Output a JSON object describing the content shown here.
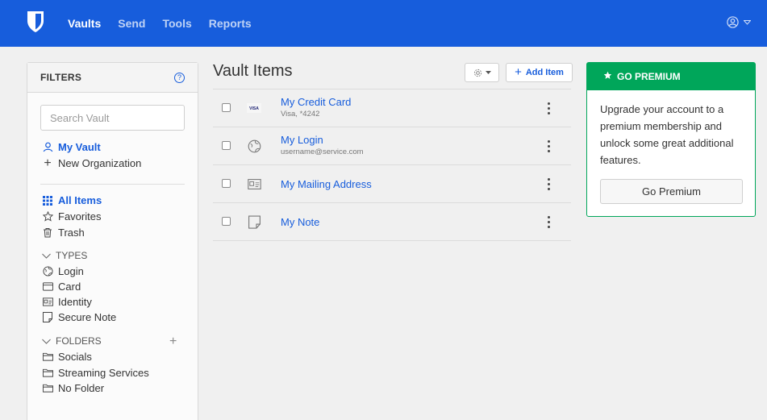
{
  "colors": {
    "brand": "#175ddc",
    "premium": "#00a65a"
  },
  "nav": {
    "logo_icon": "bitwarden-shield-icon",
    "links": [
      "Vaults",
      "Send",
      "Tools",
      "Reports"
    ],
    "active": "Vaults",
    "account_icon": "account-circle-icon"
  },
  "filters": {
    "title": "FILTERS",
    "help_icon": "help-circle-icon",
    "search_placeholder": "Search Vault",
    "my_vault": "My Vault",
    "new_org": "New Organization",
    "all_items": "All Items",
    "favorites": "Favorites",
    "trash": "Trash",
    "types_label": "TYPES",
    "types": [
      "Login",
      "Card",
      "Identity",
      "Secure Note"
    ],
    "folders_label": "FOLDERS",
    "folders": [
      "Socials",
      "Streaming Services",
      "No Folder"
    ]
  },
  "vault": {
    "title": "Vault Items",
    "add_item": "Add Item",
    "items": [
      {
        "name": "My Credit Card",
        "sub": "Visa, *4242",
        "icon": "visa-card-icon"
      },
      {
        "name": "My Login",
        "sub": "username@service.com",
        "icon": "globe-icon"
      },
      {
        "name": "My Mailing Address",
        "sub": "",
        "icon": "id-card-icon"
      },
      {
        "name": "My Note",
        "sub": "",
        "icon": "sticky-note-icon"
      }
    ]
  },
  "premium": {
    "title": "GO PREMIUM",
    "body": "Upgrade your account to a premium membership and unlock some great additional features.",
    "button": "Go Premium"
  }
}
